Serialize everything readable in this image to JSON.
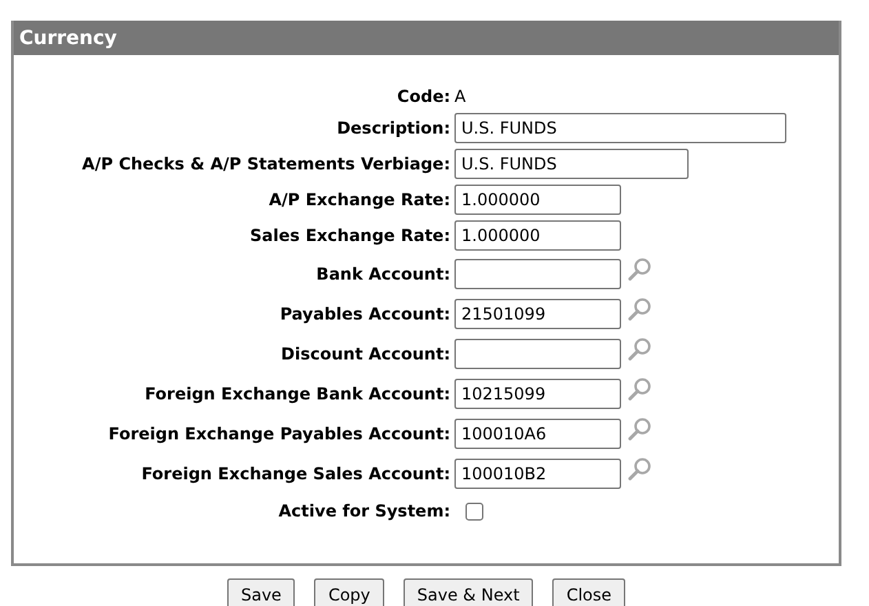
{
  "panel": {
    "title": "Currency"
  },
  "rows": [
    {
      "kind": "text",
      "label": "Code:",
      "value": "A"
    },
    {
      "kind": "input-wide",
      "label": "Description:",
      "value": "U.S. FUNDS"
    },
    {
      "kind": "input-medium",
      "label": "A/P Checks & A/P Statements Verbiage:",
      "value": "U.S. FUNDS"
    },
    {
      "kind": "input",
      "label": "A/P Exchange Rate:",
      "value": "1.000000"
    },
    {
      "kind": "input",
      "label": "Sales Exchange Rate:",
      "value": "1.000000"
    },
    {
      "kind": "lookup",
      "label": "Bank Account:",
      "value": ""
    },
    {
      "kind": "lookup",
      "label": "Payables Account:",
      "value": "21501099"
    },
    {
      "kind": "lookup",
      "label": "Discount Account:",
      "value": ""
    },
    {
      "kind": "lookup",
      "label": "Foreign Exchange Bank Account:",
      "value": "10215099"
    },
    {
      "kind": "lookup",
      "label": "Foreign Exchange Payables Account:",
      "value": "100010A6"
    },
    {
      "kind": "lookup",
      "label": "Foreign Exchange Sales Account:",
      "value": "100010B2"
    },
    {
      "kind": "checkbox",
      "label": "Active for System:",
      "checked": false
    }
  ],
  "buttons": [
    "Save",
    "Copy",
    "Save & Next",
    "Close"
  ]
}
